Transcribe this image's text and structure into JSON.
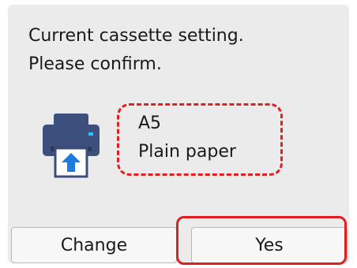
{
  "message": {
    "line1": "Current cassette setting.",
    "line2": "Please confirm."
  },
  "paper_setting": {
    "size": "A5",
    "type": "Plain paper"
  },
  "buttons": {
    "change_label": "Change",
    "yes_label": "Yes"
  },
  "icons": {
    "printer": "printer-paper-feed-icon"
  },
  "colors": {
    "highlight": "#e02020",
    "printer_body": "#3d4f7d",
    "arrow": "#1e7be0"
  }
}
